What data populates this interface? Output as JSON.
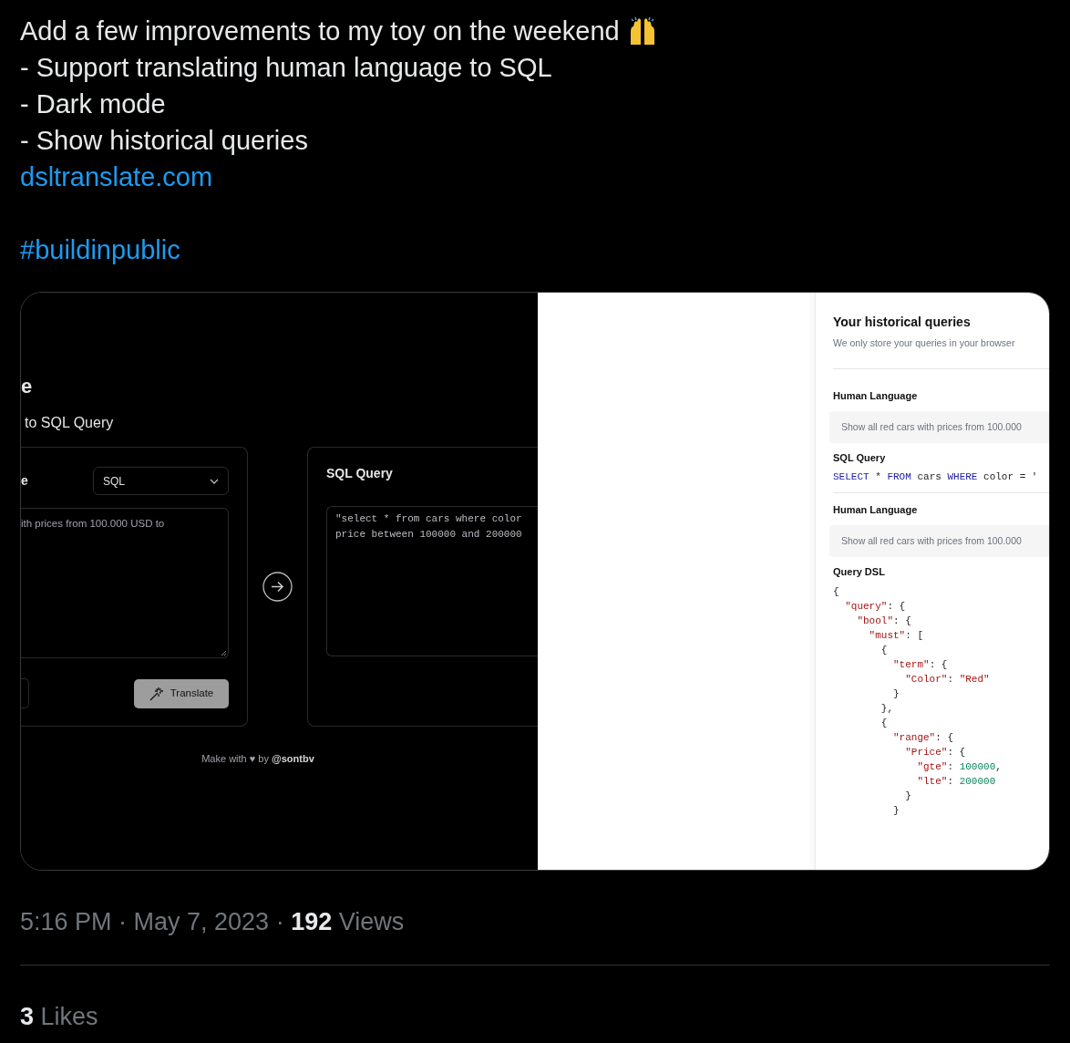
{
  "tweet": {
    "lines": [
      "Add a few improvements to my toy on the weekend",
      "- Support translating human language to SQL",
      "- Dark mode",
      "- Show historical queries"
    ],
    "link": "dsltranslate.com",
    "hashtag": "#buildinpublic"
  },
  "screenshot": {
    "dark_app": {
      "title": "e",
      "subtitle": "to SQL Query",
      "input_card": {
        "label": "e",
        "select": "SQL",
        "value": "ith prices from 100.000 USD to",
        "button": "Translate"
      },
      "output_card": {
        "title": "SQL Query",
        "code_lines": [
          "\"select * from cars where color",
          "price between 100000 and 200000"
        ]
      },
      "footer": "Make with ♥ by **@sontbv**"
    },
    "history_panel": {
      "title": "Your historical queries",
      "subtitle": "We only store your queries in your browser",
      "entries": [
        {
          "kind": "sql",
          "label": "Human Language",
          "query": "Show all red cars with prices from 100.000",
          "result_label": "SQL Query",
          "lines": [
            [
              {
                "text": "SELECT",
                "kind": "keyword"
              },
              {
                "text": " * ",
                "kind": "punct"
              },
              {
                "text": "FROM",
                "kind": "keyword"
              },
              {
                "text": " cars ",
                "kind": "punct"
              },
              {
                "text": "WHERE",
                "kind": "keyword"
              },
              {
                "text": " color = '",
                "kind": "punct"
              }
            ]
          ]
        },
        {
          "kind": "dsl",
          "label": "Human Language",
          "query": "Show all red cars with prices from 100.000",
          "result_label": "Query DSL",
          "lines": [
            [
              {
                "text": "{",
                "kind": "punct"
              }
            ],
            [
              {
                "text": "  \"query\"",
                "kind": "string"
              },
              {
                "text": ": {",
                "kind": "punct"
              }
            ],
            [
              {
                "text": "    \"bool\"",
                "kind": "string"
              },
              {
                "text": ": {",
                "kind": "punct"
              }
            ],
            [
              {
                "text": "      \"must\"",
                "kind": "string"
              },
              {
                "text": ": [",
                "kind": "punct"
              }
            ],
            [
              {
                "text": "        {",
                "kind": "punct"
              }
            ],
            [
              {
                "text": "          \"term\"",
                "kind": "string"
              },
              {
                "text": ": {",
                "kind": "punct"
              }
            ],
            [
              {
                "text": "            \"Color\"",
                "kind": "string"
              },
              {
                "text": ": ",
                "kind": "punct"
              },
              {
                "text": "\"Red\"",
                "kind": "string"
              }
            ],
            [
              {
                "text": "          }",
                "kind": "punct"
              }
            ],
            [
              {
                "text": "        },",
                "kind": "punct"
              }
            ],
            [
              {
                "text": "        {",
                "kind": "punct"
              }
            ],
            [
              {
                "text": "          \"range\"",
                "kind": "string"
              },
              {
                "text": ": {",
                "kind": "punct"
              }
            ],
            [
              {
                "text": "            \"Price\"",
                "kind": "string"
              },
              {
                "text": ": {",
                "kind": "punct"
              }
            ],
            [
              {
                "text": "              \"gte\"",
                "kind": "string"
              },
              {
                "text": ": ",
                "kind": "punct"
              },
              {
                "text": "100000",
                "kind": "number"
              },
              {
                "text": ",",
                "kind": "punct"
              }
            ],
            [
              {
                "text": "              \"lte\"",
                "kind": "string"
              },
              {
                "text": ": ",
                "kind": "punct"
              },
              {
                "text": "200000",
                "kind": "number"
              }
            ],
            [
              {
                "text": "            }",
                "kind": "punct"
              }
            ],
            [
              {
                "text": "          }",
                "kind": "punct"
              }
            ]
          ]
        }
      ]
    }
  },
  "meta": "5:16 PM · May 7, 2023 · **192** Views",
  "likes": "**3** Likes"
}
